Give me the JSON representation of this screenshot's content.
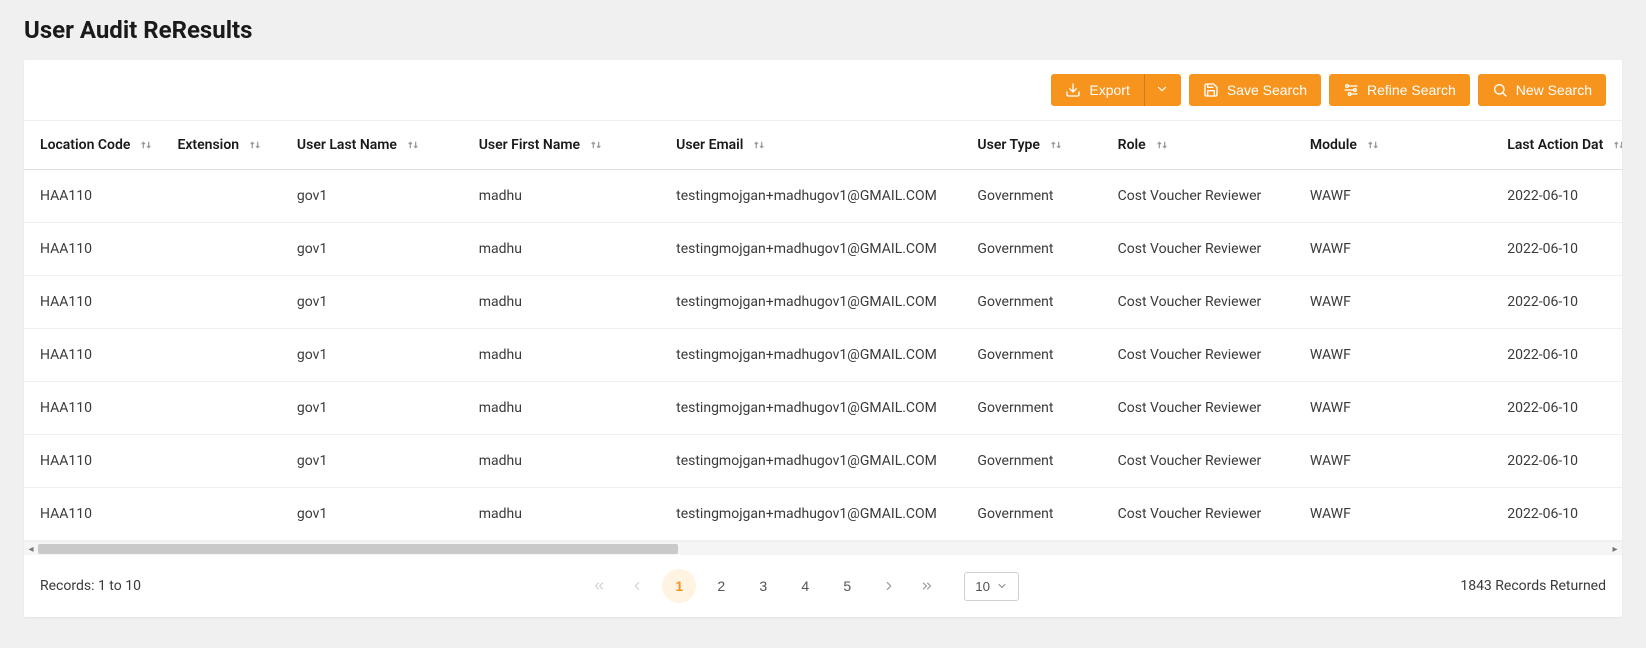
{
  "page": {
    "title": "User Audit ReResults"
  },
  "toolbar": {
    "export_label": "Export",
    "save_search_label": "Save Search",
    "refine_search_label": "Refine Search",
    "new_search_label": "New Search"
  },
  "table": {
    "columns": [
      {
        "key": "location_code",
        "label": "Location Code"
      },
      {
        "key": "extension",
        "label": "Extension"
      },
      {
        "key": "user_last",
        "label": "User Last Name"
      },
      {
        "key": "user_first",
        "label": "User First Name"
      },
      {
        "key": "user_email",
        "label": "User Email"
      },
      {
        "key": "user_type",
        "label": "User Type"
      },
      {
        "key": "role",
        "label": "Role"
      },
      {
        "key": "module",
        "label": "Module"
      },
      {
        "key": "last_action",
        "label": "Last Action Dat"
      }
    ],
    "rows": [
      {
        "location_code": "HAA110",
        "extension": "",
        "user_last": "gov1",
        "user_first": "madhu",
        "user_email": "testingmojgan+madhugov1@GMAIL.COM",
        "user_type": "Government",
        "role": "Cost Voucher Reviewer",
        "module": "WAWF",
        "last_action": "2022-06-10"
      },
      {
        "location_code": "HAA110",
        "extension": "",
        "user_last": "gov1",
        "user_first": "madhu",
        "user_email": "testingmojgan+madhugov1@GMAIL.COM",
        "user_type": "Government",
        "role": "Cost Voucher Reviewer",
        "module": "WAWF",
        "last_action": "2022-06-10"
      },
      {
        "location_code": "HAA110",
        "extension": "",
        "user_last": "gov1",
        "user_first": "madhu",
        "user_email": "testingmojgan+madhugov1@GMAIL.COM",
        "user_type": "Government",
        "role": "Cost Voucher Reviewer",
        "module": "WAWF",
        "last_action": "2022-06-10"
      },
      {
        "location_code": "HAA110",
        "extension": "",
        "user_last": "gov1",
        "user_first": "madhu",
        "user_email": "testingmojgan+madhugov1@GMAIL.COM",
        "user_type": "Government",
        "role": "Cost Voucher Reviewer",
        "module": "WAWF",
        "last_action": "2022-06-10"
      },
      {
        "location_code": "HAA110",
        "extension": "",
        "user_last": "gov1",
        "user_first": "madhu",
        "user_email": "testingmojgan+madhugov1@GMAIL.COM",
        "user_type": "Government",
        "role": "Cost Voucher Reviewer",
        "module": "WAWF",
        "last_action": "2022-06-10"
      },
      {
        "location_code": "HAA110",
        "extension": "",
        "user_last": "gov1",
        "user_first": "madhu",
        "user_email": "testingmojgan+madhugov1@GMAIL.COM",
        "user_type": "Government",
        "role": "Cost Voucher Reviewer",
        "module": "WAWF",
        "last_action": "2022-06-10"
      },
      {
        "location_code": "HAA110",
        "extension": "",
        "user_last": "gov1",
        "user_first": "madhu",
        "user_email": "testingmojgan+madhugov1@GMAIL.COM",
        "user_type": "Government",
        "role": "Cost Voucher Reviewer",
        "module": "WAWF",
        "last_action": "2022-06-10"
      }
    ]
  },
  "pagination": {
    "records_label": "Records: 1 to 10",
    "pages": [
      "1",
      "2",
      "3",
      "4",
      "5"
    ],
    "active_page": "1",
    "page_size": "10",
    "total_label": "1843 Records Returned"
  }
}
